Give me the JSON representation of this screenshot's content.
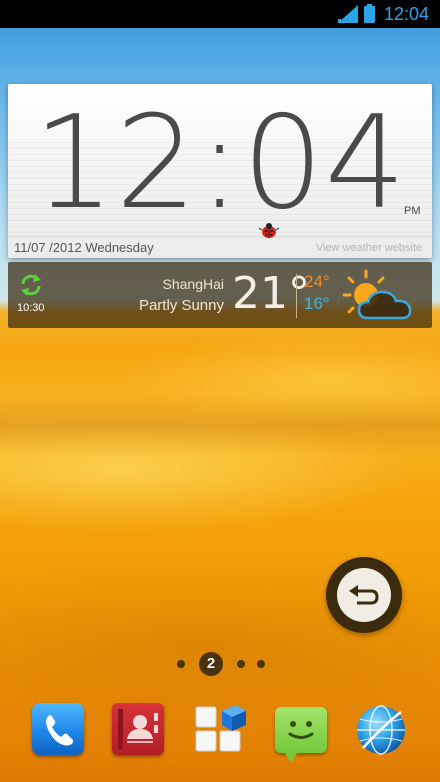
{
  "status_bar": {
    "time": "12:04",
    "signal_icon": "signal-bars-icon",
    "battery_icon": "battery-icon",
    "accent_color": "#2aa6e8"
  },
  "clock_widget": {
    "time": "12:04",
    "ampm": "PM",
    "date": "11/07 /2012 Wednesday",
    "weather_link": "View weather website"
  },
  "weather": {
    "last_updated": "10:30",
    "city": "ShangHai",
    "condition": "Partly Sunny",
    "temperature": "21°",
    "high": "24°",
    "low": "16°",
    "high_color": "#f08a2a",
    "low_color": "#38b8e6",
    "icon": "partly-sunny-icon"
  },
  "home_screen": {
    "page_indicator": {
      "current_page": "2",
      "total_pages": 4
    },
    "floating_button_icon": "back-arrow-icon"
  },
  "dock": {
    "apps": [
      {
        "name": "phone",
        "icon": "phone-icon"
      },
      {
        "name": "contacts",
        "icon": "contacts-book-icon"
      },
      {
        "name": "apps",
        "icon": "app-drawer-icon"
      },
      {
        "name": "messaging",
        "icon": "sms-icon"
      },
      {
        "name": "browser",
        "icon": "globe-icon"
      }
    ]
  }
}
